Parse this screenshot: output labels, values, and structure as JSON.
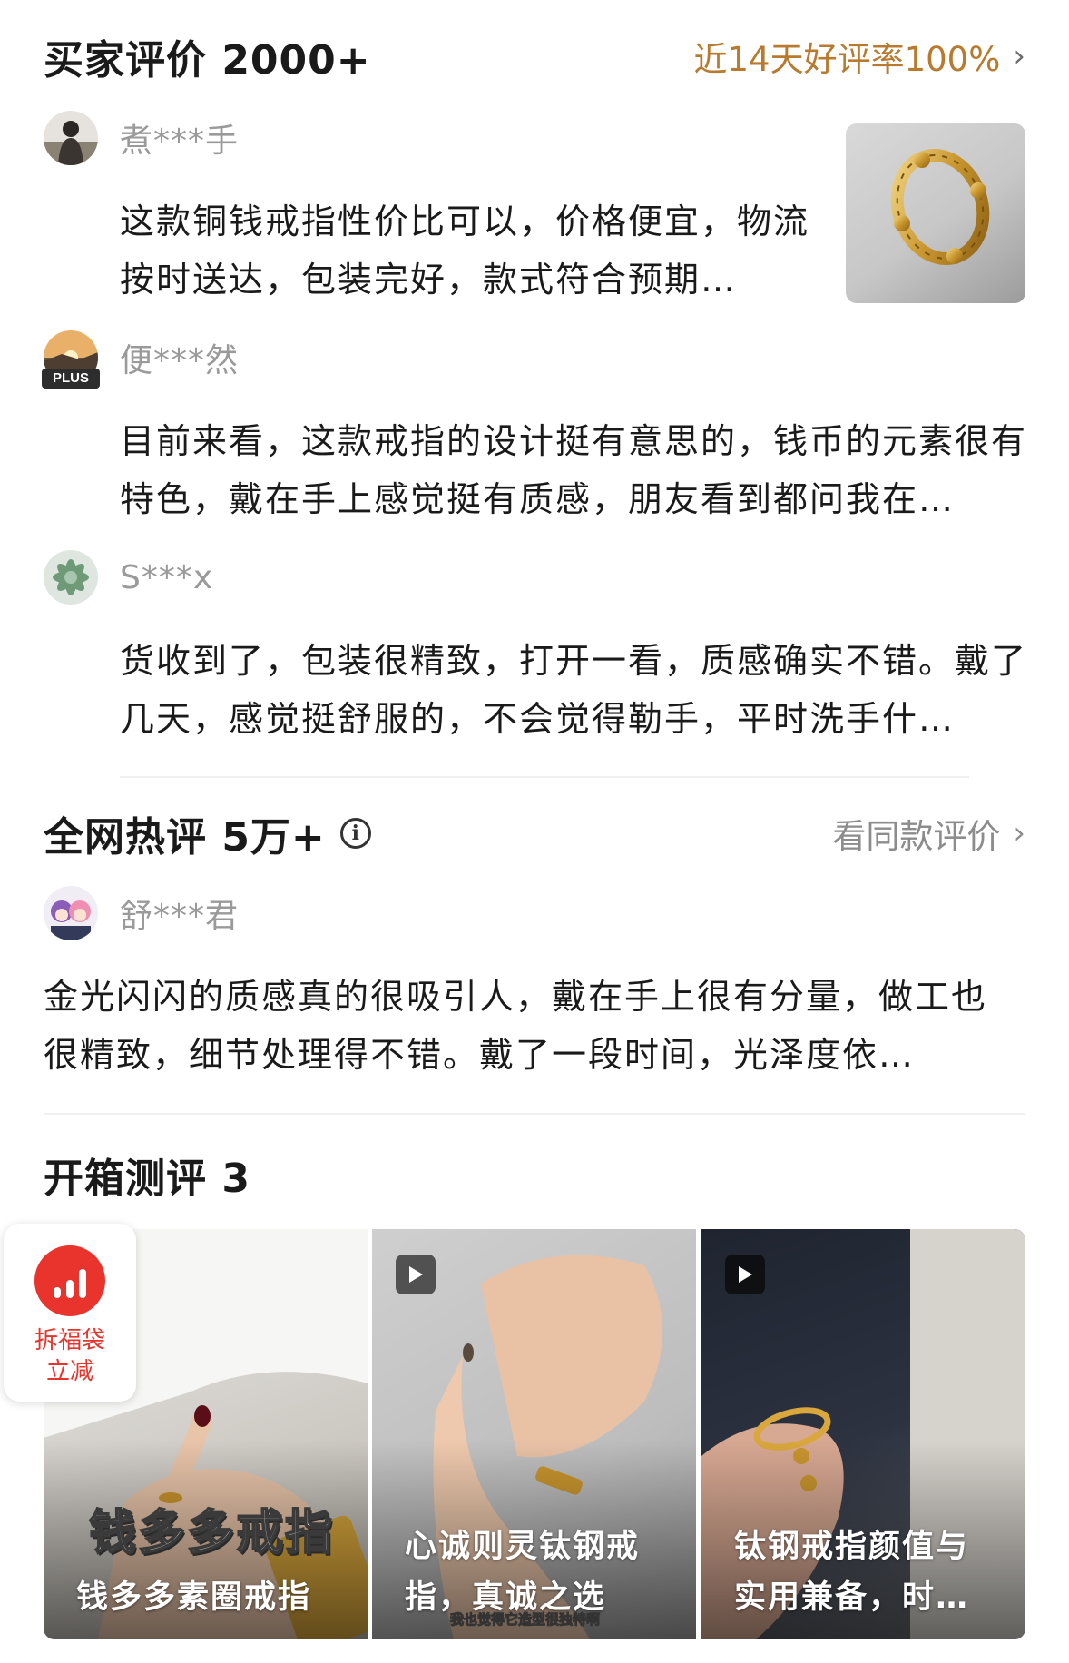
{
  "buyer_reviews": {
    "title": "买家评价 2000+",
    "rate_text": "近14天好评率100%",
    "reviews": [
      {
        "name": "煮***手",
        "text": "这款铜钱戒指性价比可以，价格便宜，物流按时送达，包装完好，款式符合预期…",
        "has_image": true
      },
      {
        "name": "便***然",
        "badge": "PLUS",
        "text": "目前来看，这款戒指的设计挺有意思的，钱币的元素很有特色，戴在手上感觉挺有质感，朋友看到都问我在…"
      },
      {
        "name": "S***x",
        "text": "货收到了，包装很精致，打开一看，质感确实不错。戴了几天，感觉挺舒服的，不会觉得勒手，平时洗手什…"
      }
    ]
  },
  "hot_reviews": {
    "title": "全网热评 5万+",
    "info_icon": "info-icon",
    "see_link": "看同款评价",
    "review": {
      "name": "舒***君",
      "text": "金光闪闪的质感真的很吸引人，戴在手上很有分量，做工也很精致，细节处理得不错。戴了一段时间，光泽度依…"
    }
  },
  "unboxing": {
    "title": "开箱测评 3",
    "videos": [
      {
        "overlay_title": "钱多多戒指",
        "caption": "钱多多素圈戒指",
        "has_play_icon": false
      },
      {
        "caption": "心诚则灵钛钢戒指，真诚之选",
        "sub_overlay": "我也觉得它造型很独特啊",
        "has_play_icon": true
      },
      {
        "caption": "钛钢戒指颜值与实用兼备，时…",
        "has_play_icon": true
      }
    ]
  },
  "floating_badge": {
    "line1": "拆福袋",
    "line2": "立减",
    "icon": "bar-chart-icon",
    "color": "#e8342c"
  },
  "colors": {
    "accent_gold": "#b87a2f",
    "muted_text": "#9a9a9a",
    "badge_red": "#e8342c"
  }
}
